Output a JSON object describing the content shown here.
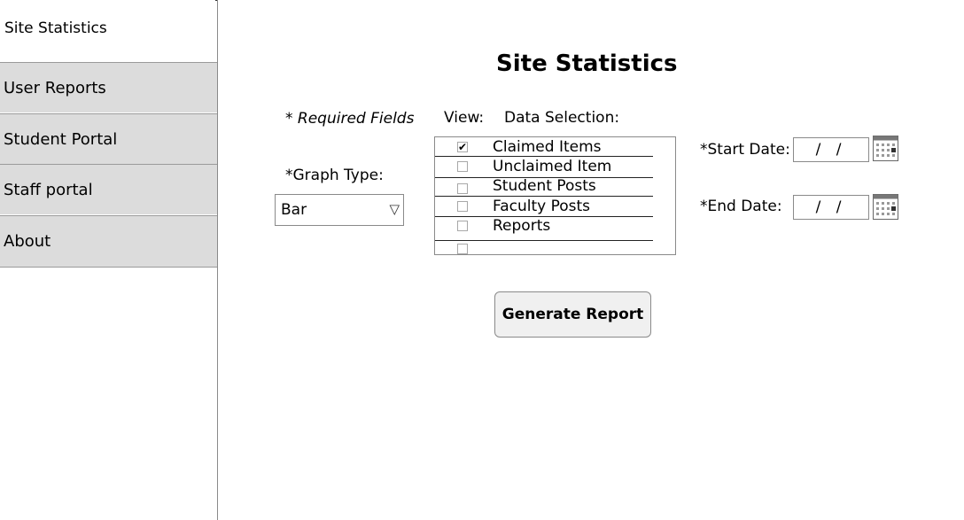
{
  "sidebar": {
    "title": "Site Statistics",
    "items": [
      {
        "label": "User Reports"
      },
      {
        "label": "Student Portal"
      },
      {
        "label": "Staff portal"
      },
      {
        "label": "About"
      }
    ]
  },
  "main": {
    "title": "Site Statistics",
    "required_note": "* Required Fields",
    "view_label": "View:",
    "data_selection_label": "Data Selection:",
    "graph_type_label": "*Graph Type:",
    "graph_type_value": "Bar",
    "data_items": [
      {
        "label": "Claimed Items",
        "checked": true
      },
      {
        "label": "Unclaimed Item",
        "checked": false
      },
      {
        "label": "Student Posts",
        "checked": false
      },
      {
        "label": "Faculty Posts",
        "checked": false
      },
      {
        "label": "Reports",
        "checked": false
      },
      {
        "label": "",
        "checked": false
      }
    ],
    "start_date_label": "*Start Date:",
    "start_date_value": "/ /",
    "end_date_label": "*End Date:",
    "end_date_value": "/ /",
    "generate_button_label": "Generate Report"
  },
  "icons": {
    "checkmark": "✔",
    "dropdown": "chevron-down-icon",
    "calendar": "calendar-icon"
  }
}
